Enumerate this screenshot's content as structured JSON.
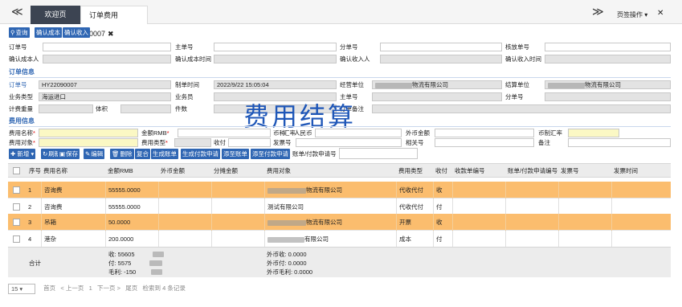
{
  "topbar": {
    "nav_left": "≪",
    "tab_home": "欢迎页",
    "tab_active": "订单费用0007",
    "tab_close": "✖",
    "nav_right": "≫",
    "tab_ops": "页签操作 ▾",
    "fullscreen": "✕"
  },
  "toolbar1": {
    "query": "查询",
    "confirm_cost": "确认成本",
    "confirm_income": "确认收入"
  },
  "search": {
    "order_no": "订单号",
    "master_no": "主单号",
    "sub_no": "分单号",
    "release_no": "核放单号",
    "confirm_cost_person": "确认成本人",
    "confirm_cost_time": "确认成本时间",
    "confirm_income_person": "确认收入人",
    "confirm_income_time": "确认收入时间"
  },
  "order_info": {
    "title": "订单信息",
    "order_no_label": "订单号",
    "order_no_value": "HY22090007",
    "create_time_label": "制单时间",
    "create_time_value": "2022/9/22 15:05:04",
    "operating_unit_label": "经营单位",
    "operating_unit_value": "物流有限公司",
    "settle_unit_label": "结算单位",
    "settle_unit_value": "物流有限公司",
    "business_type_label": "业务类型",
    "business_type_value": "海运进口",
    "salesman_label": "业务员",
    "master_no_label": "主单号",
    "sub_no_label": "分单号",
    "weight_label": "计费重量",
    "volume_label": "体积",
    "pieces_label": "件数",
    "remark_label": "订单备注"
  },
  "big_title": "费用结算",
  "fee_info": {
    "title": "费用信息",
    "fee_name_label": "费用名称",
    "amount_rmb_label": "金额RMB",
    "currency_label": "币种",
    "exchange_rate_label": "汇率",
    "payer_label": "人民币",
    "foreign_amount_label": "外币金额",
    "currency_rate_label": "币制汇率",
    "fee_target_label": "费用对象",
    "fee_type_label": "费用类型",
    "receive_pay_label": "收付",
    "invoice_no_label": "发票号",
    "related_no_label": "相关号",
    "note_label": "备注"
  },
  "toolbar2": {
    "add": "新增",
    "refresh": "刷新",
    "save": "保存",
    "edit": "编辑",
    "delete": "删除",
    "review": "复合",
    "gen_bill": "生成账单",
    "gen_pay_req": "生成付款申请",
    "add_to_bill": "添至账单",
    "add_to_pay_req": "添至付款申请",
    "bill_pay_req_label": "账单/付款申请号"
  },
  "table": {
    "headers": [
      "序号",
      "费用名称",
      "金额RMB",
      "外币金额",
      "分摊金额",
      "费用对象",
      "费用类型",
      "收付",
      "收款单编号",
      "账单/付款申请编号",
      "发票号",
      "发票时间"
    ],
    "rows": [
      {
        "no": "1",
        "name": "咨询费",
        "amount": "55555.0000",
        "foreign": "",
        "share": "",
        "target": "物流有限公司",
        "type": "代收代付",
        "rp": "收",
        "highlight": true
      },
      {
        "no": "2",
        "name": "咨询费",
        "amount": "55555.0000",
        "foreign": "",
        "share": "",
        "target": "测试有限公司",
        "type": "代收代付",
        "rp": "付",
        "highlight": false
      },
      {
        "no": "3",
        "name": "吊箱",
        "amount": "50.0000",
        "foreign": "",
        "share": "",
        "target": "物流有限公司",
        "type": "开票",
        "rp": "收",
        "highlight": true
      },
      {
        "no": "4",
        "name": "港杂",
        "amount": "200.0000",
        "foreign": "",
        "share": "",
        "target": "有限公司",
        "type": "成本",
        "rp": "付",
        "highlight": false
      }
    ],
    "summary": {
      "label": "合计",
      "receive": "收:   55605",
      "pay": "付:   5575",
      "profit": "毛利: -150",
      "foreign_receive": "外币收:   0.0000",
      "foreign_pay": "外币付:   0.0000",
      "foreign_profit": "外币毛利: 0.0000"
    }
  },
  "pager": {
    "page_size": "15",
    "first": "首页",
    "prev": "< 上一页",
    "page": "1",
    "next": "下一页 >",
    "last": "尾页",
    "total": "检索到 4 条记录"
  }
}
